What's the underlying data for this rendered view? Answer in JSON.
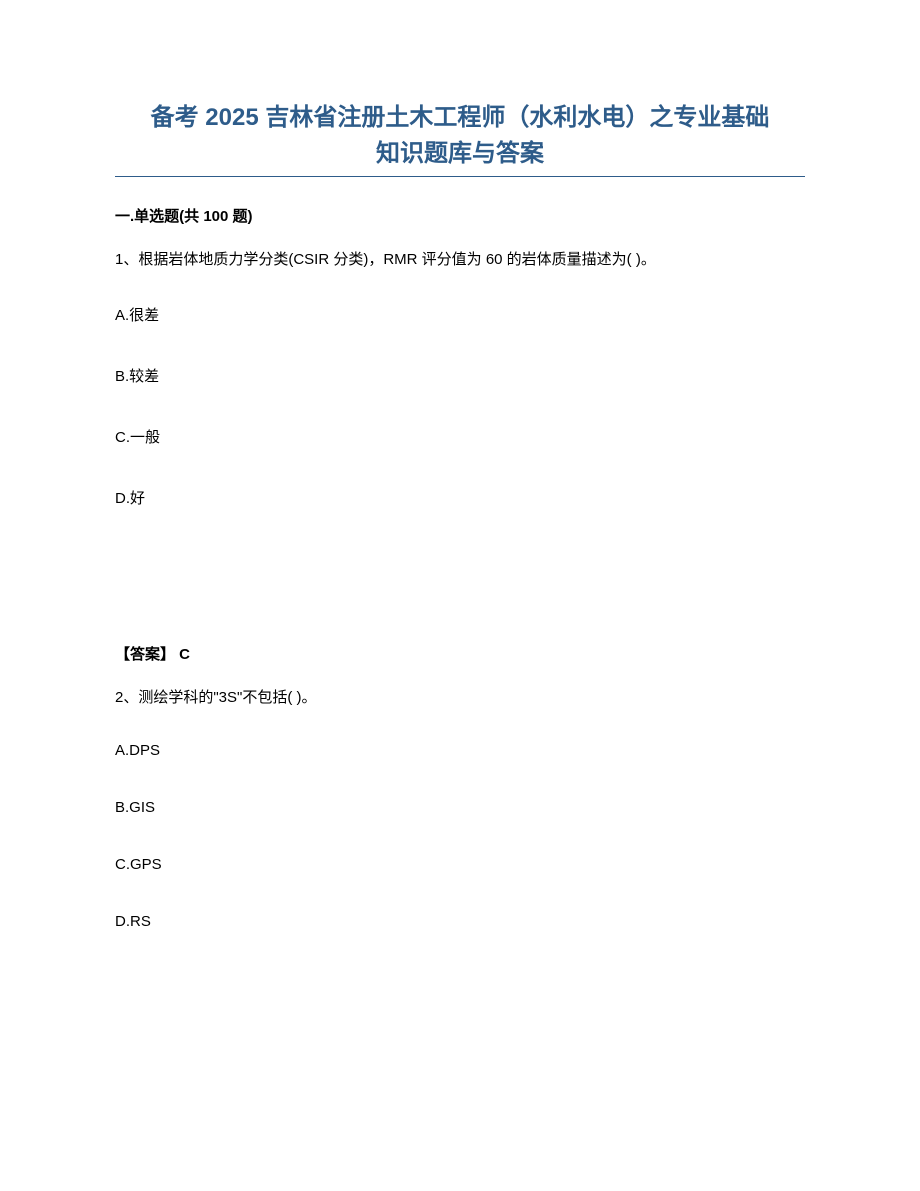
{
  "title_line1": "备考 2025 吉林省注册土木工程师（水利水电）之专业基础",
  "title_line2": "知识题库与答案",
  "section_heading": "一.单选题(共 100 题)",
  "q1": {
    "text": "1、根据岩体地质力学分类(CSIR 分类)，RMR 评分值为 60 的岩体质量描述为(  )。",
    "option_a": "A.很差",
    "option_b": "B.较差",
    "option_c": "C.一般",
    "option_d": "D.好",
    "answer": "【答案】 C"
  },
  "q2": {
    "text": "2、测绘学科的\"3S\"不包括(  )。",
    "option_a": "A.DPS",
    "option_b": "B.GIS",
    "option_c": "C.GPS",
    "option_d": "D.RS"
  }
}
